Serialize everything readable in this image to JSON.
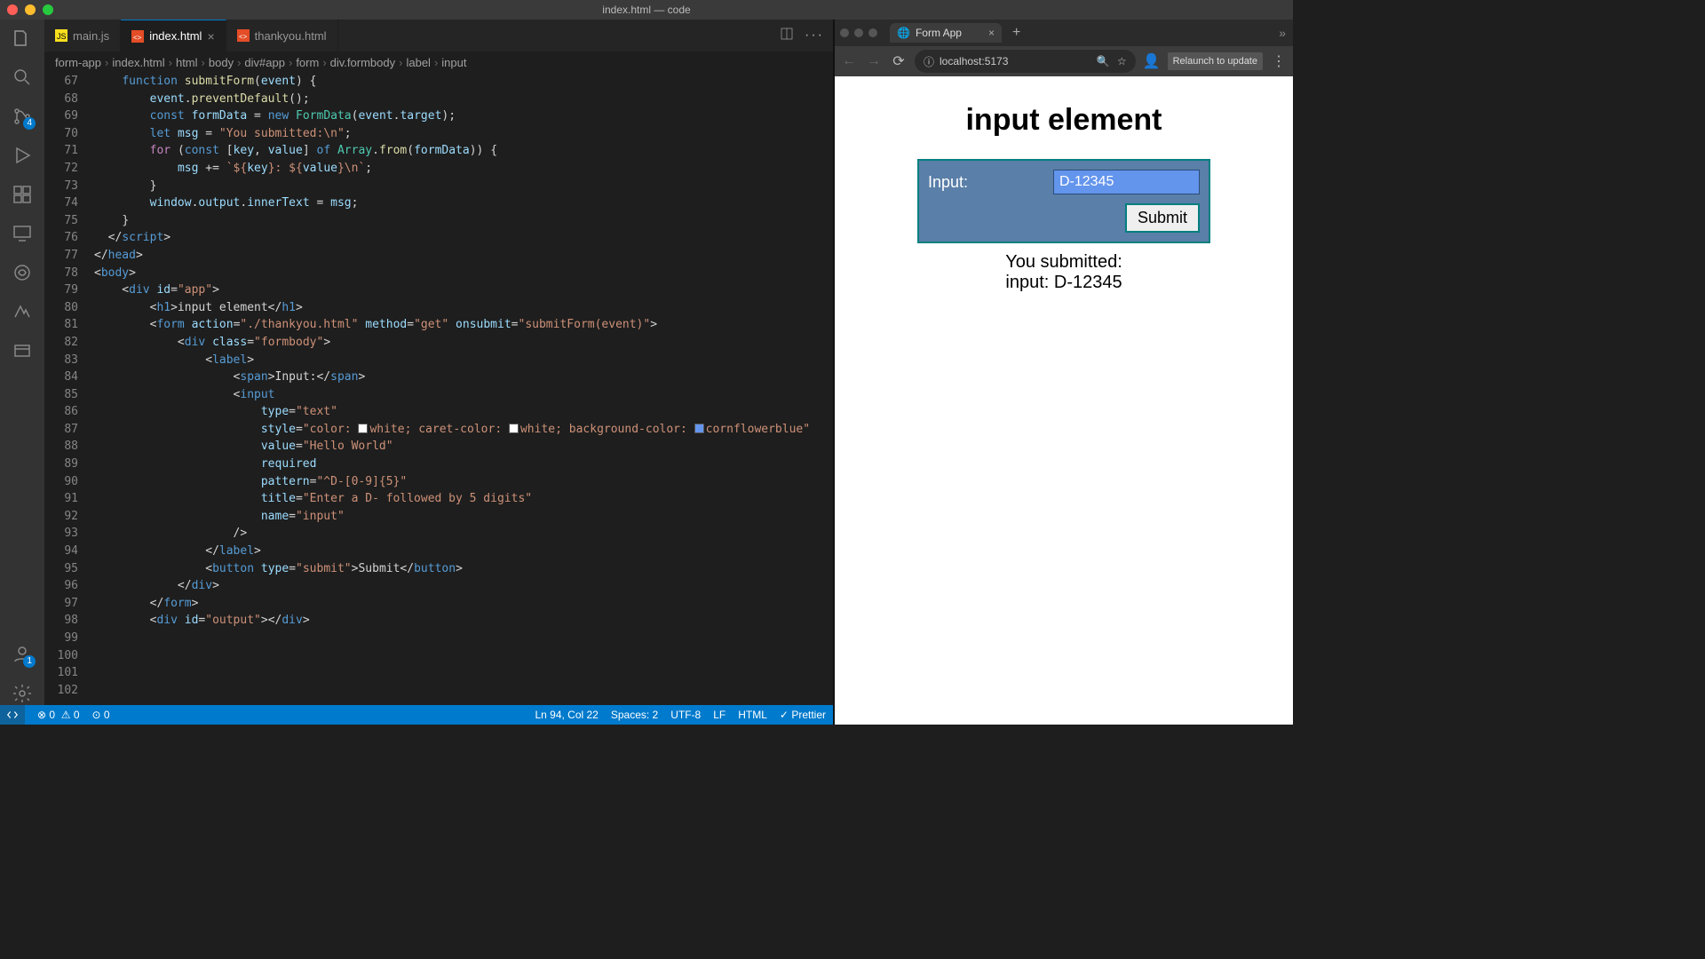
{
  "window_title": "index.html — code",
  "activity_badges": {
    "scm": "4",
    "accounts": "1"
  },
  "tabs": [
    {
      "icon": "js",
      "label": "main.js",
      "active": false
    },
    {
      "icon": "html",
      "label": "index.html",
      "active": true
    },
    {
      "icon": "html",
      "label": "thankyou.html",
      "active": false
    }
  ],
  "breadcrumbs": [
    "form-app",
    "index.html",
    "html",
    "body",
    "div#app",
    "form",
    "div.formbody",
    "label",
    "input"
  ],
  "first_line_no": 67,
  "code": [
    [
      [
        "kw",
        "function "
      ],
      [
        "fn",
        "submitForm"
      ],
      [
        "pun",
        "("
      ],
      [
        "var",
        "event"
      ],
      [
        "pun",
        ") {"
      ]
    ],
    [
      [
        "pun",
        "  "
      ],
      [
        "var",
        "event"
      ],
      [
        "pun",
        "."
      ],
      [
        "fn",
        "preventDefault"
      ],
      [
        "pun",
        "();"
      ]
    ],
    [],
    [
      [
        "pun",
        "  "
      ],
      [
        "kw",
        "const "
      ],
      [
        "var",
        "formData"
      ],
      [
        "pun",
        " = "
      ],
      [
        "kw",
        "new "
      ],
      [
        "type",
        "FormData"
      ],
      [
        "pun",
        "("
      ],
      [
        "var",
        "event"
      ],
      [
        "pun",
        "."
      ],
      [
        "var",
        "target"
      ],
      [
        "pun",
        ");"
      ]
    ],
    [
      [
        "pun",
        "  "
      ],
      [
        "kw",
        "let "
      ],
      [
        "var",
        "msg"
      ],
      [
        "pun",
        " = "
      ],
      [
        "str",
        "\"You submitted:\\n\""
      ],
      [
        "pun",
        ";"
      ]
    ],
    [],
    [
      [
        "pun",
        "  "
      ],
      [
        "ctrl",
        "for "
      ],
      [
        "pun",
        "("
      ],
      [
        "kw",
        "const "
      ],
      [
        "pun",
        "["
      ],
      [
        "var",
        "key"
      ],
      [
        "pun",
        ", "
      ],
      [
        "var",
        "value"
      ],
      [
        "pun",
        "] "
      ],
      [
        "kw",
        "of "
      ],
      [
        "type",
        "Array"
      ],
      [
        "pun",
        "."
      ],
      [
        "fn",
        "from"
      ],
      [
        "pun",
        "("
      ],
      [
        "var",
        "formData"
      ],
      [
        "pun",
        ")) {"
      ]
    ],
    [
      [
        "pun",
        "    "
      ],
      [
        "var",
        "msg"
      ],
      [
        "pun",
        " += "
      ],
      [
        "str",
        "`${"
      ],
      [
        "var",
        "key"
      ],
      [
        "str",
        "}: ${"
      ],
      [
        "var",
        "value"
      ],
      [
        "str",
        "}\\n`"
      ],
      [
        "pun",
        ";"
      ]
    ],
    [
      [
        "pun",
        "  }"
      ]
    ],
    [],
    [
      [
        "pun",
        "  "
      ],
      [
        "var",
        "window"
      ],
      [
        "pun",
        "."
      ],
      [
        "var",
        "output"
      ],
      [
        "pun",
        "."
      ],
      [
        "var",
        "innerText"
      ],
      [
        "pun",
        " = "
      ],
      [
        "var",
        "msg"
      ],
      [
        "pun",
        ";"
      ]
    ],
    [
      [
        "pun",
        "}"
      ]
    ],
    [
      [
        "pun",
        "</"
      ],
      [
        "tag",
        "script"
      ],
      [
        "pun",
        ">"
      ]
    ],
    [
      [
        "pun",
        "</"
      ],
      [
        "tag",
        "head"
      ],
      [
        "pun",
        ">"
      ]
    ],
    [
      [
        "pun",
        "<"
      ],
      [
        "tag",
        "body"
      ],
      [
        "pun",
        ">"
      ]
    ],
    [
      [
        "pun",
        "  <"
      ],
      [
        "tag",
        "div "
      ],
      [
        "attr",
        "id"
      ],
      [
        "pun",
        "="
      ],
      [
        "str",
        "\"app\""
      ],
      [
        "pun",
        ">"
      ]
    ],
    [
      [
        "pun",
        "    <"
      ],
      [
        "tag",
        "h1"
      ],
      [
        "pun",
        ">input element</"
      ],
      [
        "tag",
        "h1"
      ],
      [
        "pun",
        ">"
      ]
    ],
    [
      [
        "pun",
        "    <"
      ],
      [
        "tag",
        "form "
      ],
      [
        "attr",
        "action"
      ],
      [
        "pun",
        "="
      ],
      [
        "str",
        "\"./thankyou.html\""
      ],
      [
        "pun",
        " "
      ],
      [
        "attr",
        "method"
      ],
      [
        "pun",
        "="
      ],
      [
        "str",
        "\"get\""
      ],
      [
        "pun",
        " "
      ],
      [
        "attr",
        "onsubmit"
      ],
      [
        "pun",
        "="
      ],
      [
        "str",
        "\"submitForm(event)\""
      ],
      [
        "pun",
        ">"
      ]
    ],
    [
      [
        "pun",
        "      <"
      ],
      [
        "tag",
        "div "
      ],
      [
        "attr",
        "class"
      ],
      [
        "pun",
        "="
      ],
      [
        "str",
        "\"formbody\""
      ],
      [
        "pun",
        ">"
      ]
    ],
    [
      [
        "pun",
        "        <"
      ],
      [
        "tag",
        "label"
      ],
      [
        "pun",
        ">"
      ]
    ],
    [
      [
        "pun",
        "          <"
      ],
      [
        "tag",
        "span"
      ],
      [
        "pun",
        ">Input:</"
      ],
      [
        "tag",
        "span"
      ],
      [
        "pun",
        ">"
      ]
    ],
    [
      [
        "pun",
        "          <"
      ],
      [
        "tag",
        "input"
      ]
    ],
    [
      [
        "pun",
        "            "
      ],
      [
        "attr",
        "type"
      ],
      [
        "pun",
        "="
      ],
      [
        "str",
        "\"text\""
      ]
    ],
    [
      [
        "pun",
        "            "
      ],
      [
        "attr",
        "style"
      ],
      [
        "pun",
        "="
      ],
      [
        "str",
        "\"color: "
      ],
      [
        "swatch",
        "#ffffff"
      ],
      [
        "str",
        "white; caret-color: "
      ],
      [
        "swatch",
        "#ffffff"
      ],
      [
        "str",
        "white; background-color: "
      ],
      [
        "swatch",
        "#6495ed"
      ],
      [
        "str",
        "cornflowerblue\""
      ]
    ],
    [
      [
        "pun",
        "            "
      ],
      [
        "attr",
        "value"
      ],
      [
        "pun",
        "="
      ],
      [
        "str",
        "\"Hello World\""
      ]
    ],
    [
      [
        "pun",
        "            "
      ],
      [
        "attr",
        "required"
      ]
    ],
    [
      [
        "pun",
        "            "
      ],
      [
        "attr",
        "pattern"
      ],
      [
        "pun",
        "="
      ],
      [
        "str",
        "\"^D-[0-9]{5}\""
      ]
    ],
    [
      [
        "pun",
        "            "
      ],
      [
        "attr",
        "title"
      ],
      [
        "pun",
        "="
      ],
      [
        "str",
        "\"Enter a D- followed by 5 digits\""
      ]
    ],
    [
      [
        "pun",
        "            "
      ],
      [
        "attr",
        "name"
      ],
      [
        "pun",
        "="
      ],
      [
        "str",
        "\"input\""
      ]
    ],
    [
      [
        "pun",
        "          />"
      ]
    ],
    [
      [
        "pun",
        "        </"
      ],
      [
        "tag",
        "label"
      ],
      [
        "pun",
        ">"
      ]
    ],
    [],
    [
      [
        "pun",
        "        <"
      ],
      [
        "tag",
        "button "
      ],
      [
        "attr",
        "type"
      ],
      [
        "pun",
        "="
      ],
      [
        "str",
        "\"submit\""
      ],
      [
        "pun",
        ">Submit</"
      ],
      [
        "tag",
        "button"
      ],
      [
        "pun",
        ">"
      ]
    ],
    [
      [
        "pun",
        "      </"
      ],
      [
        "tag",
        "div"
      ],
      [
        "pun",
        ">"
      ]
    ],
    [
      [
        "pun",
        "    </"
      ],
      [
        "tag",
        "form"
      ],
      [
        "pun",
        ">"
      ]
    ],
    [
      [
        "pun",
        "    <"
      ],
      [
        "tag",
        "div "
      ],
      [
        "attr",
        "id"
      ],
      [
        "pun",
        "="
      ],
      [
        "str",
        "\"output\""
      ],
      [
        "pun",
        "></"
      ],
      [
        "tag",
        "div"
      ],
      [
        "pun",
        ">"
      ]
    ]
  ],
  "status": {
    "errors": "0",
    "warnings": "0",
    "ports": "0",
    "cursor": "Ln 94, Col 22",
    "spaces": "Spaces: 2",
    "encoding": "UTF-8",
    "eol": "LF",
    "lang": "HTML",
    "formatter": "Prettier"
  },
  "browser": {
    "tab_title": "Form App",
    "url": "localhost:5173",
    "relaunch": "Relaunch to update",
    "page_heading": "input element",
    "label": "Input:",
    "input_value": "D-12345",
    "submit": "Submit",
    "output": "You submitted:\ninput: D-12345"
  }
}
